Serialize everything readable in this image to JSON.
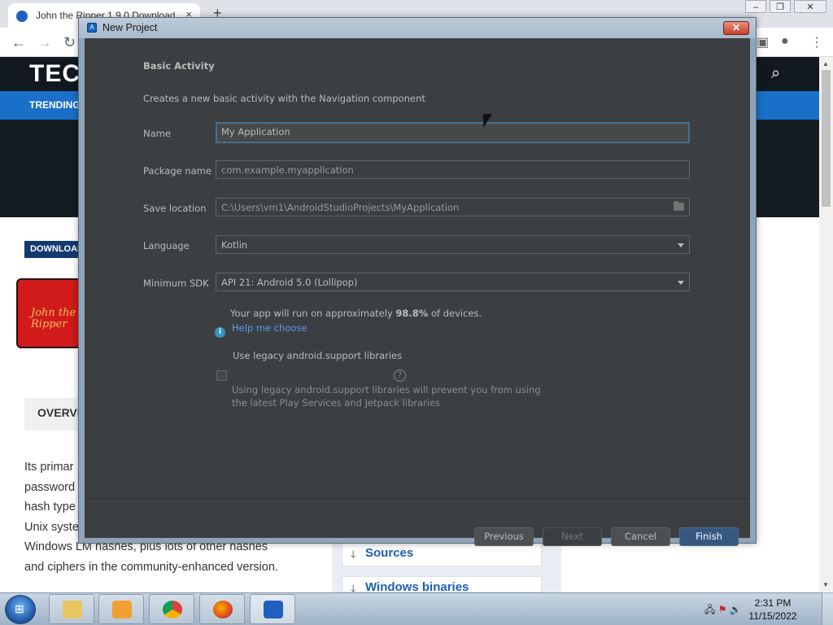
{
  "browser": {
    "tab_title": "John the Ripper 1.9.0 Download",
    "tab_close": "×",
    "new_tab": "+",
    "window_controls": [
      "‒",
      "❐",
      "✕"
    ]
  },
  "website": {
    "logo": "TEC",
    "trending": "TRENDING",
    "download_badge": "DOWNLOAD",
    "jtr_logo_text": "John the Ripper",
    "overview_tab": "OVERVI",
    "body_lines": [
      "Its primar",
      "password",
      "hash type",
      "Unix syste",
      "Windows LM hashes, plus lots of other hashes",
      "and ciphers in the community-enhanced version."
    ],
    "side_links": [
      "Sources",
      "Windows binaries"
    ]
  },
  "dialog": {
    "title": "New Project",
    "close_label": "✕",
    "heading": "Basic Activity",
    "description": "Creates a new basic activity with the Navigation component",
    "name": {
      "label": "Name",
      "value": "My Application"
    },
    "package_name": {
      "label": "Package name",
      "value": "com.example.myapplication"
    },
    "save_location": {
      "label": "Save location",
      "value": "C:\\Users\\vm1\\AndroidStudioProjects\\MyApplication"
    },
    "language": {
      "label": "Language",
      "value": "Kotlin"
    },
    "minimum_sdk": {
      "label": "Minimum SDK",
      "value": "API 21: Android 5.0 (Lollipop)"
    },
    "info_prefix": "Your app will run on approximately ",
    "info_percent": "98.8%",
    "info_suffix": " of devices.",
    "help_link": "Help me choose",
    "legacy_checkbox_label": "Use legacy android.support libraries",
    "legacy_checked": false,
    "legacy_note_line1": "Using legacy android.support libraries will prevent you from using",
    "legacy_note_line2": "the latest Play Services and Jetpack libraries",
    "buttons": {
      "previous": "Previous",
      "next": "Next",
      "cancel": "Cancel",
      "finish": "Finish"
    }
  },
  "taskbar": {
    "clock_time": "2:31 PM",
    "clock_date": "11/15/2022"
  },
  "colors": {
    "dialog_bg": "#3c3f41",
    "primary_button": "#365880",
    "link": "#589df6",
    "site_header": "#111820",
    "trending_bar": "#1a6fc9"
  }
}
